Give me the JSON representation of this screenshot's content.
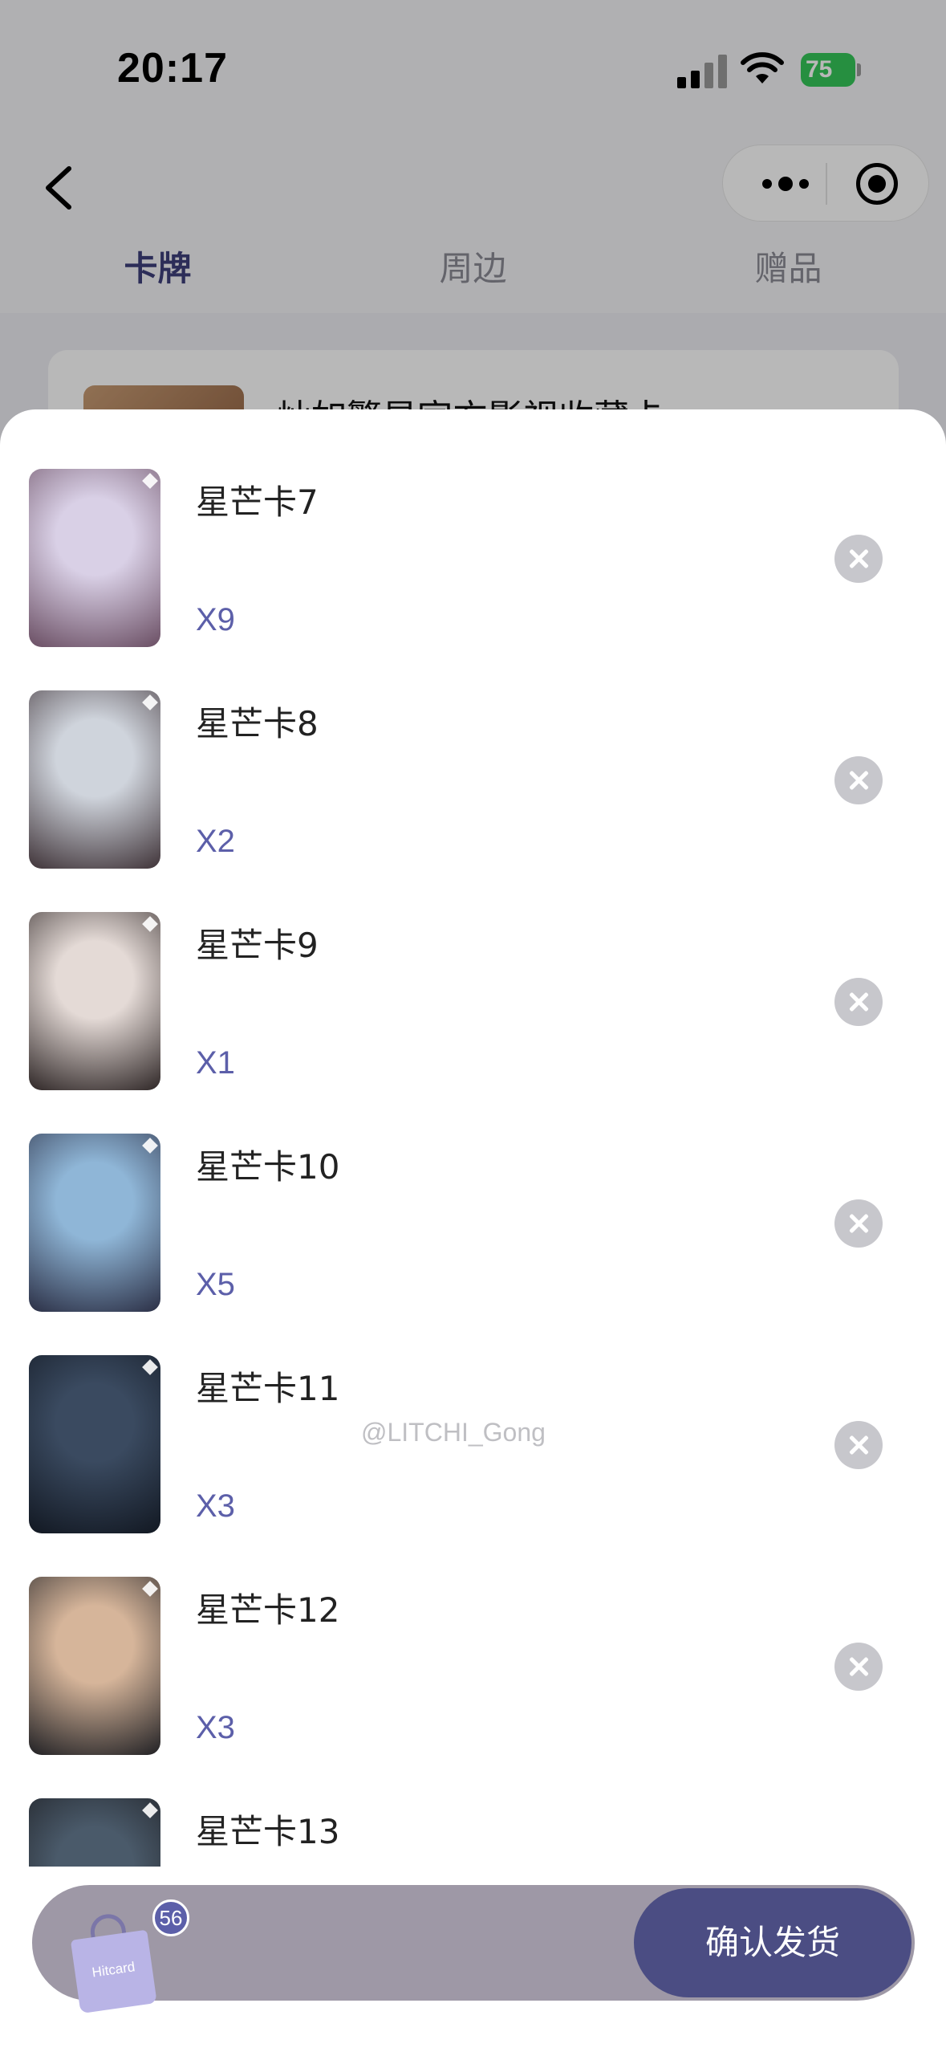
{
  "status_bar": {
    "time": "20:17",
    "battery": "75"
  },
  "nav": {
    "back_icon": "chevron-left-icon",
    "more_icon": "more-dots-icon",
    "close_icon": "target-circle-icon"
  },
  "tabs": [
    {
      "label": "卡牌",
      "active": true
    },
    {
      "label": "周边",
      "active": false
    },
    {
      "label": "赠品",
      "active": false
    }
  ],
  "background_card": {
    "title": "灿如繁星官方影视收藏卡"
  },
  "items": [
    {
      "name": "星芒卡7",
      "qty": "X9",
      "color_a": "#d9d0e6",
      "color_b": "#6a4e63"
    },
    {
      "name": "星芒卡8",
      "qty": "X2",
      "color_a": "#cfd4dc",
      "color_b": "#3f3338"
    },
    {
      "name": "星芒卡9",
      "qty": "X1",
      "color_a": "#e4dad6",
      "color_b": "#2e2626"
    },
    {
      "name": "星芒卡10",
      "qty": "X5",
      "color_a": "#8fb6d7",
      "color_b": "#2b2f45"
    },
    {
      "name": "星芒卡11",
      "qty": "X3",
      "color_a": "#3a4a60",
      "color_b": "#121822"
    },
    {
      "name": "星芒卡12",
      "qty": "X3",
      "color_a": "#d6b59a",
      "color_b": "#202024"
    },
    {
      "name": "星芒卡13",
      "qty": "",
      "color_a": "#4a5a6a",
      "color_b": "#1a1a1e"
    }
  ],
  "watermark": "@LITCHI_Gong",
  "cart": {
    "bag_label": "Hitcard",
    "count": "56",
    "confirm_label": "确认发货"
  },
  "colors": {
    "accent": "#5c5fa9",
    "confirm_bg": "#4b4d83",
    "remove_bg": "#c7c7cc"
  }
}
